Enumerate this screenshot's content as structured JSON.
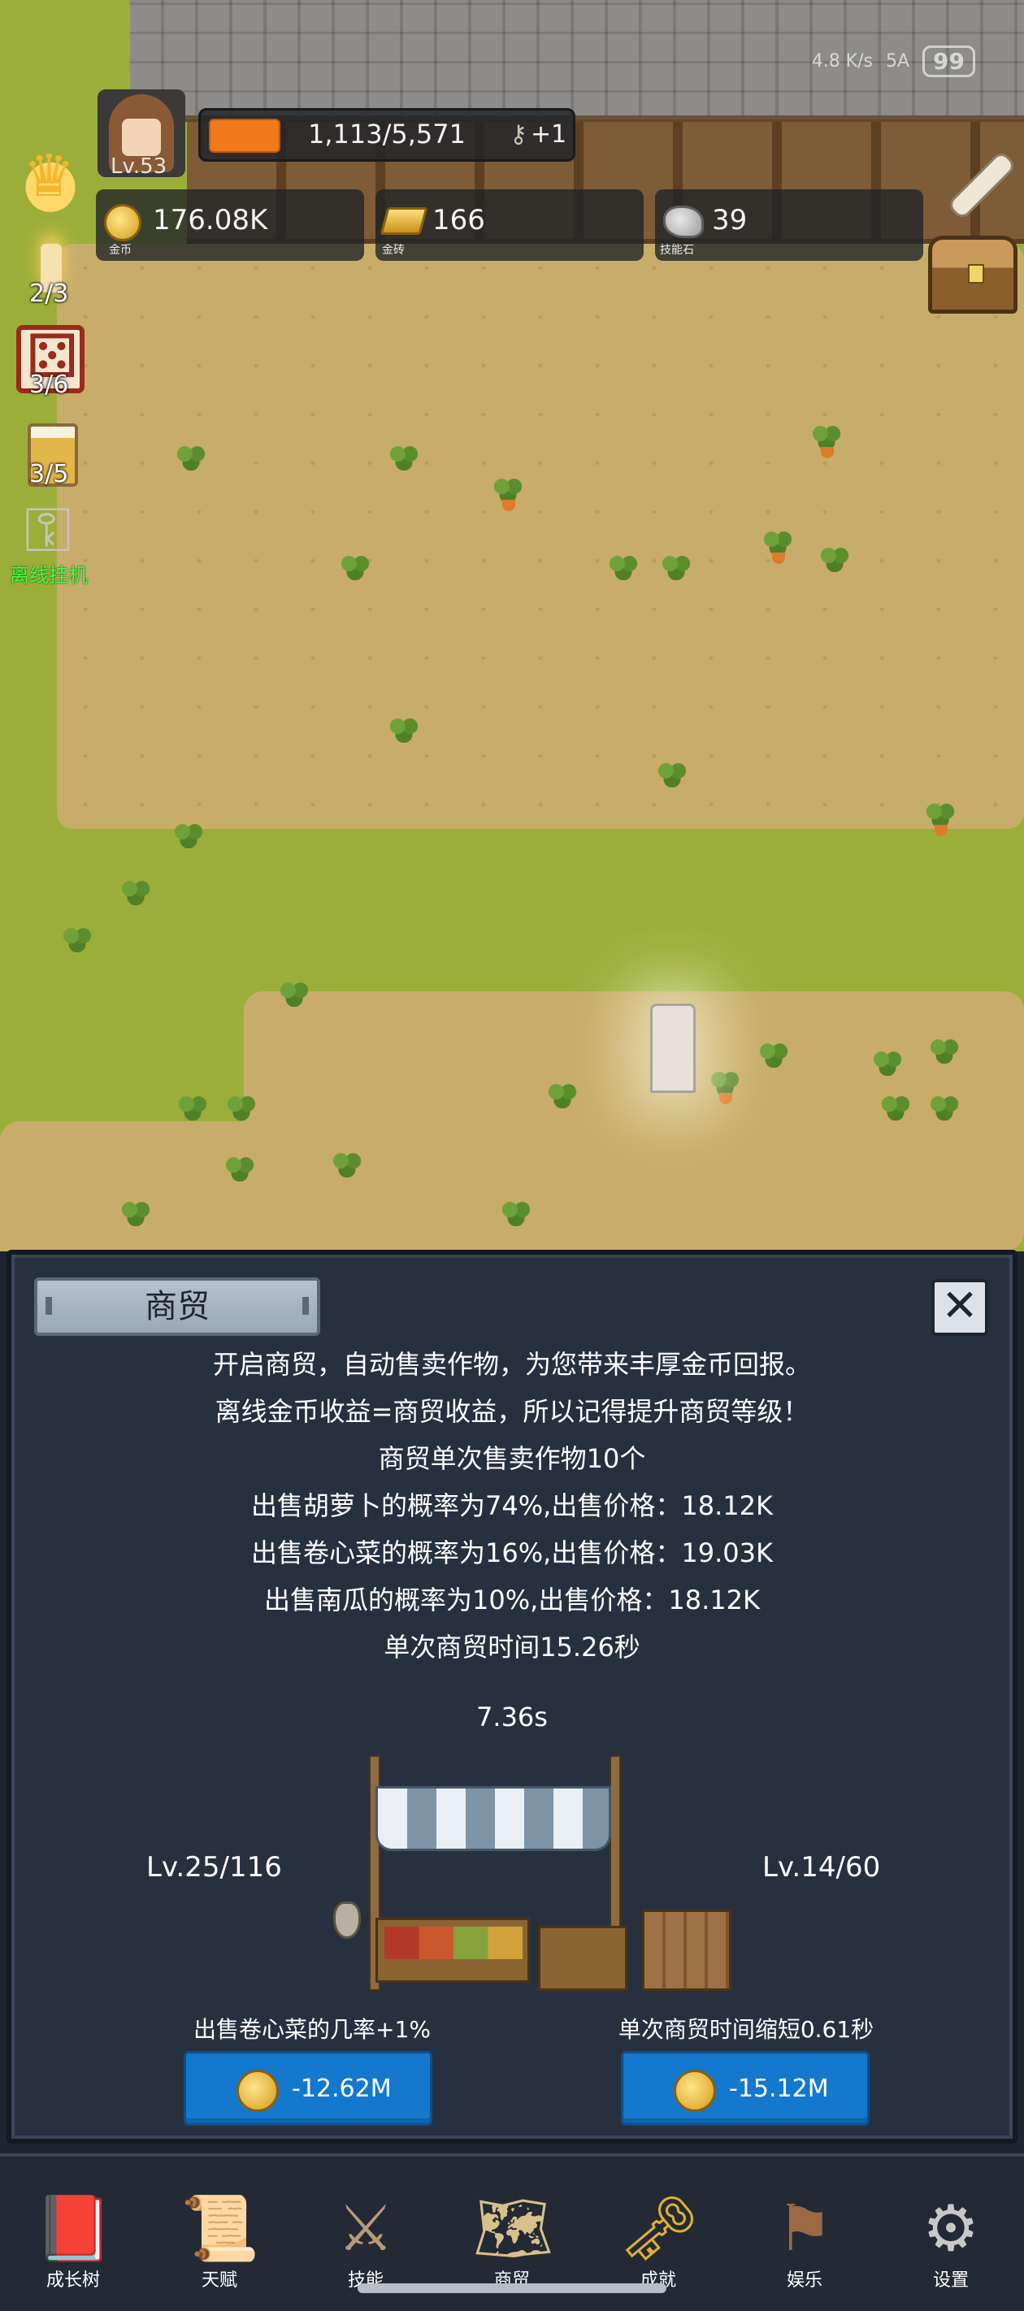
{
  "status_bar": {
    "network_speed": "4.8 K/s",
    "signal": "5A",
    "battery": "99"
  },
  "player": {
    "level": "Lv.53",
    "xp_text": "1,113/5,571",
    "xp_fraction": 0.2,
    "key_bonus": "+1"
  },
  "currencies": [
    {
      "icon": "gold-coin-icon",
      "value": "176.08K",
      "caption": "金币"
    },
    {
      "icon": "gold-bar-icon",
      "value": "166",
      "caption": "金砖"
    },
    {
      "icon": "skill-stone-icon",
      "value": "39",
      "caption": "技能石"
    }
  ],
  "side_icons": {
    "candle_count": "2/3",
    "dice_count": "3/6",
    "beer_count": "3/5",
    "offline_label": "离线挂机"
  },
  "panel": {
    "title": "商贸",
    "lines": [
      "开启商贸，自动售卖作物，为您带来丰厚金币回报。",
      "离线金币收益=商贸收益，所以记得提升商贸等级！",
      "商贸单次售卖作物10个",
      "出售胡萝卜的概率为74%,出售价格：18.12K",
      "出售卷心菜的概率为16%,出售价格：19.03K",
      "出售南瓜的概率为10%,出售价格：18.12K",
      "单次商贸时间15.26秒"
    ],
    "timer": "7.36s",
    "left_upgrade": {
      "level": "Lv.25/116",
      "description": "出售卷心菜的几率+1%",
      "cost": "-12.62M"
    },
    "right_upgrade": {
      "level": "Lv.14/60",
      "description": "单次商贸时间缩短0.61秒",
      "cost": "-15.12M"
    }
  },
  "nav": [
    {
      "label": "成长树",
      "icon": "book-icon"
    },
    {
      "label": "天赋",
      "icon": "scroll-icon"
    },
    {
      "label": "技能",
      "icon": "sword-icon"
    },
    {
      "label": "商贸",
      "icon": "map-icon"
    },
    {
      "label": "成就",
      "icon": "key-icon"
    },
    {
      "label": "娱乐",
      "icon": "flag-icon"
    },
    {
      "label": "设置",
      "icon": "gear-icon"
    }
  ],
  "colors": {
    "xp": "#f07a1a",
    "button": "#1478cf",
    "panel": "#27303f",
    "offline": "#44ff44"
  }
}
